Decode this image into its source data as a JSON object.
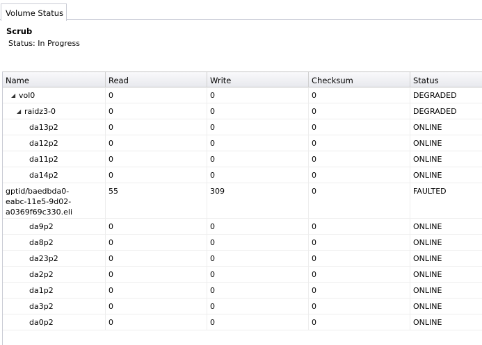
{
  "tabs": [
    {
      "label": "Volume Status"
    }
  ],
  "scrub": {
    "title": "Scrub",
    "status": "Status: In Progress"
  },
  "grid": {
    "columns": [
      "Name",
      "Read",
      "Write",
      "Checksum",
      "Status"
    ],
    "rows": [
      {
        "name": "vol0",
        "expander": "◢",
        "read": "0",
        "write": "0",
        "checksum": "0",
        "status": "DEGRADED"
      },
      {
        "name": "raidz3-0",
        "expander": "◢",
        "read": "0",
        "write": "0",
        "checksum": "0",
        "status": "DEGRADED"
      },
      {
        "name": "da13p2",
        "read": "0",
        "write": "0",
        "checksum": "0",
        "status": "ONLINE"
      },
      {
        "name": "da12p2",
        "read": "0",
        "write": "0",
        "checksum": "0",
        "status": "ONLINE"
      },
      {
        "name": "da11p2",
        "read": "0",
        "write": "0",
        "checksum": "0",
        "status": "ONLINE"
      },
      {
        "name": "da14p2",
        "read": "0",
        "write": "0",
        "checksum": "0",
        "status": "ONLINE"
      },
      {
        "name": "gptid/baedbda0-\neabc-11e5-9d02-\na0369f69c330.eli",
        "read": "55",
        "write": "309",
        "checksum": "0",
        "status": "FAULTED"
      },
      {
        "name": "da9p2",
        "read": "0",
        "write": "0",
        "checksum": "0",
        "status": "ONLINE"
      },
      {
        "name": "da8p2",
        "read": "0",
        "write": "0",
        "checksum": "0",
        "status": "ONLINE"
      },
      {
        "name": "da23p2",
        "read": "0",
        "write": "0",
        "checksum": "0",
        "status": "ONLINE"
      },
      {
        "name": "da2p2",
        "read": "0",
        "write": "0",
        "checksum": "0",
        "status": "ONLINE"
      },
      {
        "name": "da1p2",
        "read": "0",
        "write": "0",
        "checksum": "0",
        "status": "ONLINE"
      },
      {
        "name": "da3p2",
        "read": "0",
        "write": "0",
        "checksum": "0",
        "status": "ONLINE"
      },
      {
        "name": "da0p2",
        "read": "0",
        "write": "0",
        "checksum": "0",
        "status": "ONLINE"
      }
    ]
  }
}
